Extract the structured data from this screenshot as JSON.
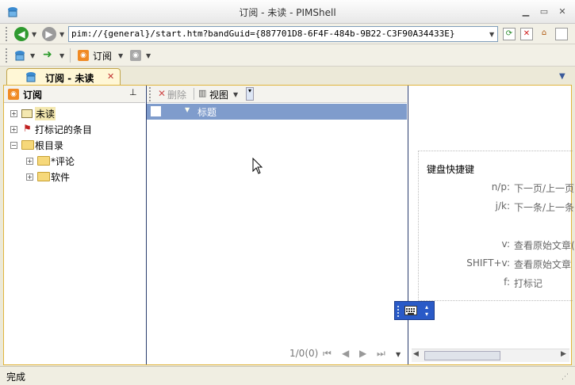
{
  "window": {
    "title": "订阅 - 未读 - PIMShell"
  },
  "address": {
    "url": "pim://{general}/start.htm?bandGuid={887701D8-6F4F-484b-9B22-C3F90A34433E}"
  },
  "toolbar": {
    "subscribe_label": "订阅"
  },
  "tab": {
    "label": "订阅 - 未读"
  },
  "left": {
    "header": "订阅",
    "tree": [
      {
        "label": "未读"
      },
      {
        "label": "打标记的条目"
      },
      {
        "label": "根目录"
      },
      {
        "label": "*评论"
      },
      {
        "label": "软件"
      }
    ]
  },
  "middle": {
    "delete_label": "删除",
    "view_label": "视图",
    "column_title": "标题",
    "pager_text": "1/0(0)"
  },
  "shortcuts": {
    "heading": "键盘快捷键",
    "rows": [
      {
        "key": "n/p:",
        "desc": "下一页/上一页"
      },
      {
        "key": "j/k:",
        "desc": "下一条/上一条"
      },
      {
        "key": "v:",
        "desc": "查看原始文章(在后"
      },
      {
        "key": "SHIFT+v:",
        "desc": "查看原始文章"
      },
      {
        "key": "f:",
        "desc": "打标记"
      }
    ]
  },
  "status": {
    "text": "完成"
  }
}
